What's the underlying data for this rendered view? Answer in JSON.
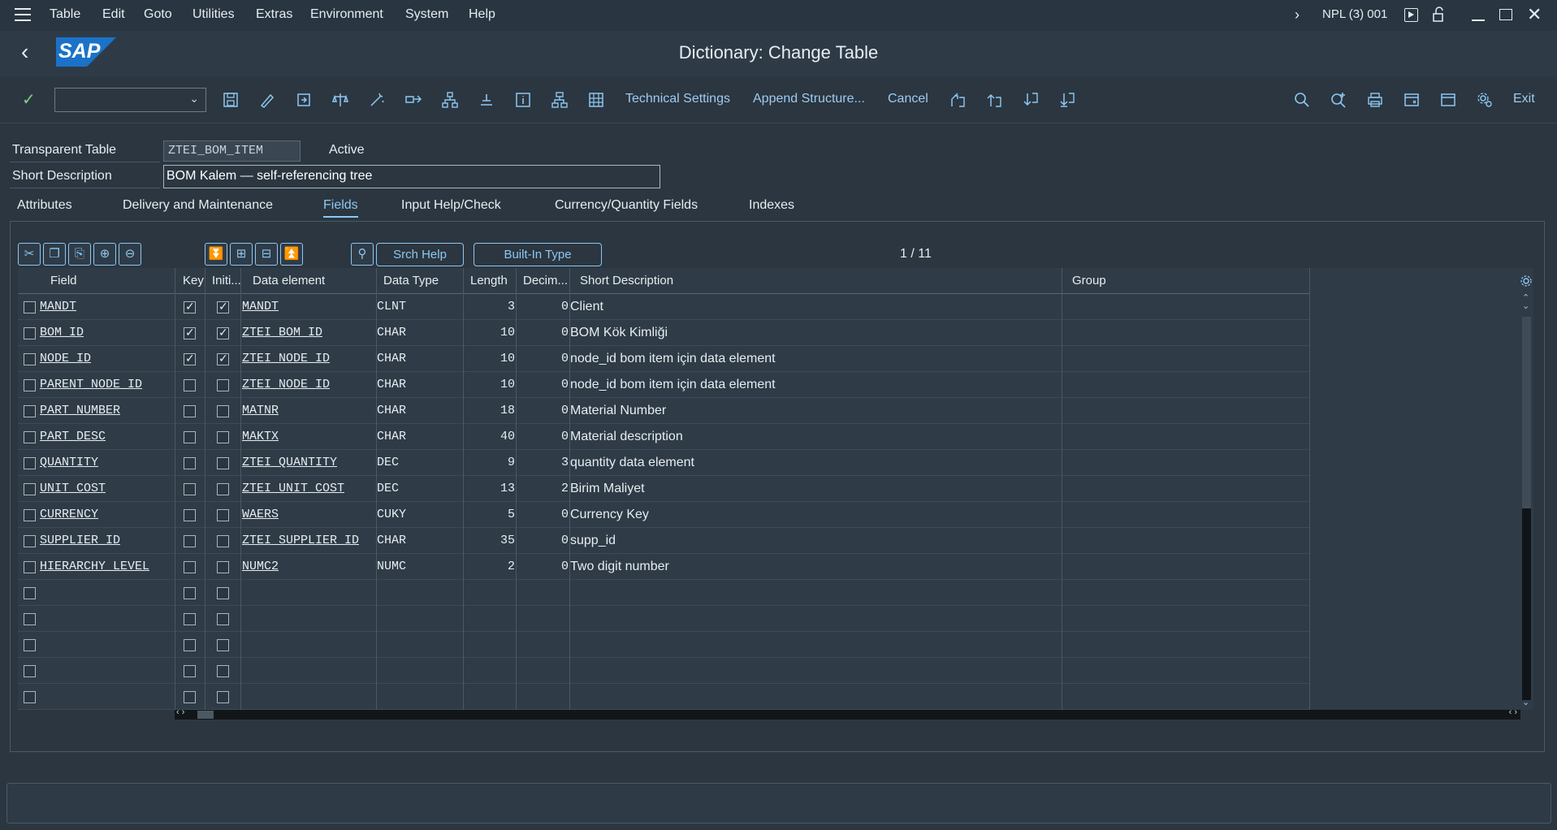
{
  "menu": [
    "Table",
    "Edit",
    "Goto",
    "Utilities",
    "Extras",
    "Environment",
    "System",
    "Help"
  ],
  "system_info": "NPL (3) 001",
  "title": "Dictionary: Change Table",
  "logo_text": "SAP",
  "toolbar": {
    "technical_settings": "Technical Settings",
    "append_structure": "Append Structure...",
    "cancel": "Cancel",
    "exit": "Exit"
  },
  "header": {
    "transparent_table_label": "Transparent Table",
    "table_name": "ZTEI_BOM_ITEM",
    "status": "Active",
    "short_description_label": "Short Description",
    "short_description": "BOM Kalem — self-referencing tree"
  },
  "tabs": [
    "Attributes",
    "Delivery and Maintenance",
    "Fields",
    "Input Help/Check",
    "Currency/Quantity Fields",
    "Indexes"
  ],
  "active_tab": "Fields",
  "grid_controls": {
    "srch_help": "Srch Help",
    "built_in_type": "Built-In Type",
    "pager": "1  /  11"
  },
  "columns": [
    "Field",
    "Key",
    "Initi...",
    "Data element",
    "Data Type",
    "Length",
    "Decim...",
    "Short Description",
    "Group"
  ],
  "rows": [
    {
      "field": "MANDT",
      "key": true,
      "init": true,
      "element": "MANDT",
      "type": "CLNT",
      "length": "3",
      "dec": "0",
      "desc": "Client"
    },
    {
      "field": "BOM_ID",
      "key": true,
      "init": true,
      "element": "ZTEI_BOM_ID",
      "type": "CHAR",
      "length": "10",
      "dec": "0",
      "desc": "BOM Kök Kimliği"
    },
    {
      "field": "NODE_ID",
      "key": true,
      "init": true,
      "element": "ZTEI_NODE_ID",
      "type": "CHAR",
      "length": "10",
      "dec": "0",
      "desc": "node_id bom item için data element"
    },
    {
      "field": "PARENT_NODE_ID",
      "key": false,
      "init": false,
      "element": "ZTEI_NODE_ID",
      "type": "CHAR",
      "length": "10",
      "dec": "0",
      "desc": "node_id bom item için data element"
    },
    {
      "field": "PART_NUMBER",
      "key": false,
      "init": false,
      "element": "MATNR",
      "type": "CHAR",
      "length": "18",
      "dec": "0",
      "desc": "Material Number"
    },
    {
      "field": "PART_DESC",
      "key": false,
      "init": false,
      "element": "MAKTX",
      "type": "CHAR",
      "length": "40",
      "dec": "0",
      "desc": "Material description"
    },
    {
      "field": "QUANTITY",
      "key": false,
      "init": false,
      "element": "ZTEI_QUANTITY",
      "type": "DEC",
      "length": "9",
      "dec": "3",
      "desc": "quantity data element"
    },
    {
      "field": "UNIT_COST",
      "key": false,
      "init": false,
      "element": "ZTEI_UNIT_COST",
      "type": "DEC",
      "length": "13",
      "dec": "2",
      "desc": " Birim Maliyet"
    },
    {
      "field": "CURRENCY",
      "key": false,
      "init": false,
      "element": "WAERS",
      "type": "CUKY",
      "length": "5",
      "dec": "0",
      "desc": "Currency Key"
    },
    {
      "field": "SUPPLIER_ID",
      "key": false,
      "init": false,
      "element": "ZTEI_SUPPLIER_ID",
      "type": "CHAR",
      "length": "35",
      "dec": "0",
      "desc": "supp_id"
    },
    {
      "field": "HIERARCHY_LEVEL",
      "key": false,
      "init": false,
      "element": "NUMC2",
      "type": "NUMC",
      "length": "2",
      "dec": "0",
      "desc": "Two digit number"
    }
  ],
  "empty_rows": 5,
  "colors": {
    "accent": "#8ec7f2",
    "background": "#2b3640",
    "logo_blue": "#1a73c8"
  }
}
